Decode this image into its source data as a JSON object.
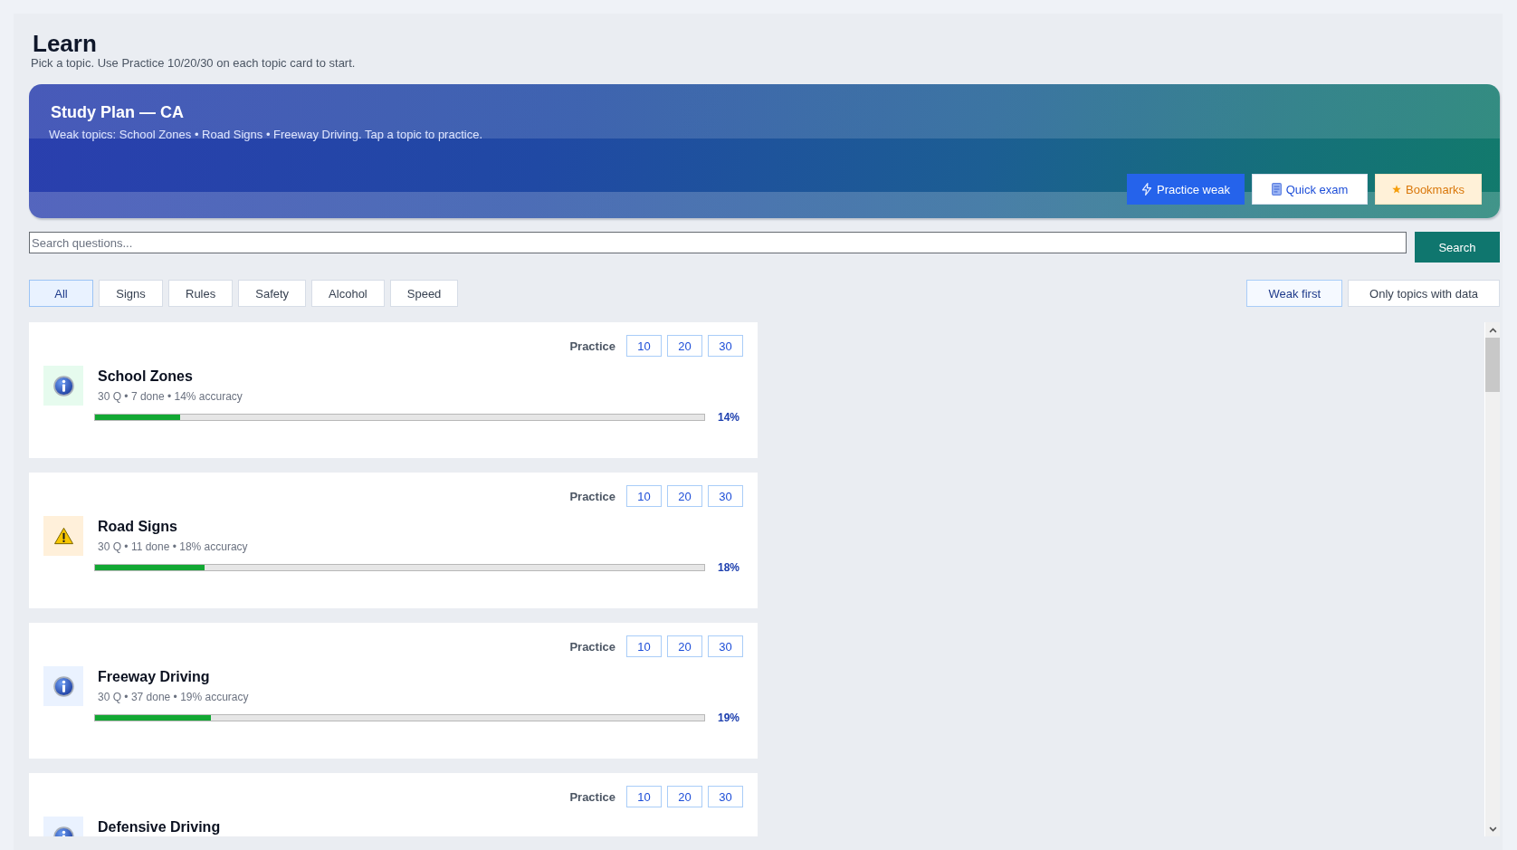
{
  "page": {
    "title": "Learn",
    "subtitle": "Pick a topic. Use Practice 10/20/30 on each topic card to start."
  },
  "study_plan": {
    "title": "Study Plan — CA",
    "text": "Weak topics: School Zones • Road Signs • Freeway Driving. Tap a topic to practice.",
    "buttons": [
      {
        "label": "Practice weak",
        "kind": "primary"
      },
      {
        "label": "Quick exam",
        "kind": "exam"
      },
      {
        "label": "Bookmarks",
        "kind": "bookmarks"
      }
    ]
  },
  "search": {
    "placeholder": "Search questions...",
    "button": "Search"
  },
  "filters": [
    {
      "label": "All",
      "selected": true
    },
    {
      "label": "Signs",
      "selected": false
    },
    {
      "label": "Rules",
      "selected": false
    },
    {
      "label": "Safety",
      "selected": false
    },
    {
      "label": "Alcohol",
      "selected": false
    },
    {
      "label": "Speed",
      "selected": false
    }
  ],
  "toggles": [
    {
      "label": "Weak first",
      "on": true
    },
    {
      "label": "Only topics with data",
      "on": false
    }
  ],
  "topics": [
    {
      "title": "School Zones",
      "kind": "info",
      "color": "#e6fbee",
      "meta": "30 Q • 7 done • 14% accuracy",
      "level": 0.14,
      "percent": "14%",
      "practice_label": "Practice",
      "practice_options": [
        "10",
        "20",
        "30"
      ]
    },
    {
      "title": "Road Signs",
      "kind": "warning",
      "color": "#fff0da",
      "meta": "30 Q • 11 done • 18% accuracy",
      "level": 0.18,
      "percent": "18%",
      "practice_label": "Practice",
      "practice_options": [
        "10",
        "20",
        "30"
      ]
    },
    {
      "title": "Freeway Driving",
      "kind": "info",
      "color": "#eaf2ff",
      "meta": "30 Q • 37 done • 19% accuracy",
      "level": 0.19,
      "percent": "19%",
      "practice_label": "Practice",
      "practice_options": [
        "10",
        "20",
        "30"
      ]
    },
    {
      "title": "Defensive Driving",
      "kind": "info",
      "color": "#eaf2ff",
      "practice_label": "Practice",
      "practice_options": [
        "10",
        "20",
        "30"
      ]
    }
  ]
}
